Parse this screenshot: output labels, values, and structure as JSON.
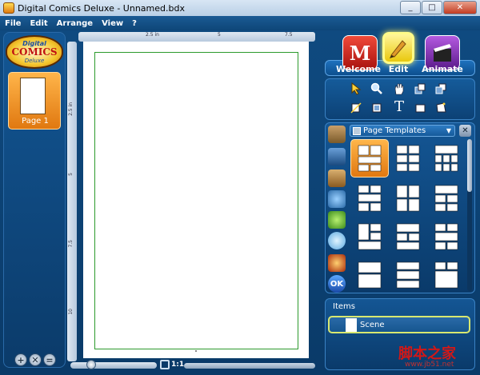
{
  "window": {
    "title": "Digital Comics Deluxe - Unnamed.bdx",
    "min": "_",
    "max": "□",
    "close": "✕"
  },
  "menu": [
    "File",
    "Edit",
    "Arrange",
    "View",
    "?"
  ],
  "logo": {
    "line1": "Digital",
    "line2": "COMICS",
    "line3": "Deluxe"
  },
  "pages": [
    {
      "label": "Page 1"
    }
  ],
  "left_buttons": [
    "+",
    "✕",
    "="
  ],
  "ruler": {
    "top_ticks": [
      "2.5 in",
      "5",
      "7.5"
    ],
    "left_ticks": [
      "2.5 in",
      "5",
      "7.5",
      "10"
    ]
  },
  "zoom": {
    "ratio": "1:1"
  },
  "modes": [
    {
      "label": "Welcome",
      "color": "#d8251c",
      "active": false
    },
    {
      "label": "Edit",
      "color": "#f6e21c",
      "active": true
    },
    {
      "label": "Animate",
      "color": "#8a2ab6",
      "active": false
    }
  ],
  "tools": {
    "row1": [
      "pointer-icon",
      "zoom-icon",
      "hand-icon",
      "bring-forward-icon",
      "send-backward-icon"
    ],
    "row2": [
      "crop-icon",
      "frame-icon",
      "text-icon",
      "rect-icon",
      "transform-icon"
    ],
    "text_glyph": "T"
  },
  "templates": {
    "dropdown_label": "Page Templates",
    "arrow": "▼",
    "close": "✕",
    "side_icons": [
      "frames-icon",
      "scenes-icon",
      "characters-icon",
      "props-icon",
      "balloon-shapes-icon",
      "speech-balloon-icon",
      "effects-icon",
      "ok-icon"
    ],
    "ok_text": "OK",
    "selected_index": 0
  },
  "items": {
    "title": "Items",
    "list": [
      {
        "label": "Scene"
      }
    ]
  },
  "watermark": {
    "text": "脚本之家",
    "url": "www.jb51.net"
  }
}
